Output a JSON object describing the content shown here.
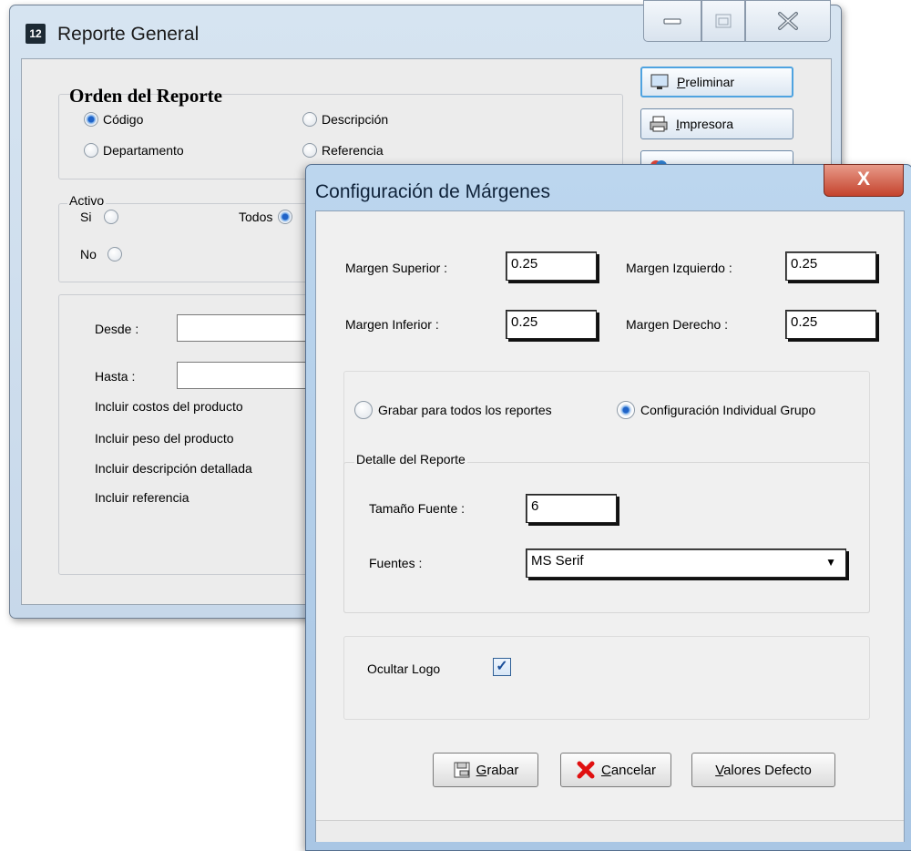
{
  "background_window": {
    "title": "Reporte General",
    "app_icon_text": "12",
    "orden": {
      "heading": "Orden del Reporte",
      "options": [
        "Código",
        "Descripción",
        "Departamento",
        "Referencia"
      ],
      "selected": "Código"
    },
    "activo": {
      "heading": "Activo",
      "si_label": "Si",
      "no_label": "No",
      "todos_label": "Todos",
      "selected": "Todos"
    },
    "range": {
      "desde_label": "Desde  :",
      "hasta_label": "Hasta   :"
    },
    "checks": [
      "Incluir costos del producto",
      "Incluir peso del producto",
      "Incluir descripción detallada",
      "Incluir referencia"
    ],
    "buttons": {
      "preliminar": "reliminar",
      "preliminar_key": "P",
      "impresora": "mpresora",
      "impresora_key": "I"
    }
  },
  "dialog": {
    "title": "Configuración de Márgenes",
    "close_glyph": "X",
    "margins": {
      "superior_label": "Margen Superior :",
      "superior_value": "0.25",
      "izquierdo_label": "Margen Izquierdo :",
      "izquierdo_value": "0.25",
      "inferior_label": "Margen Inferior :",
      "inferior_value": "0.25",
      "derecho_label": "Margen Derecho :",
      "derecho_value": "0.25"
    },
    "scope": {
      "todos_label": "Grabar para todos los reportes",
      "individual_label": "Configuración Individual Grupo",
      "selected": "Configuración Individual Grupo"
    },
    "detalle": {
      "heading": "Detalle del Reporte",
      "tamano_label": "Tamaño Fuente :",
      "tamano_value": "6",
      "fuentes_label": "Fuentes :",
      "fuentes_value": "MS Serif"
    },
    "logo": {
      "label": "Ocultar Logo",
      "checked": true
    },
    "buttons": {
      "grabar_key": "G",
      "grabar_rest": "rabar",
      "cancelar_key": "C",
      "cancelar_rest": "ancelar",
      "valores_key": "V",
      "valores_rest": "alores Defecto"
    }
  }
}
